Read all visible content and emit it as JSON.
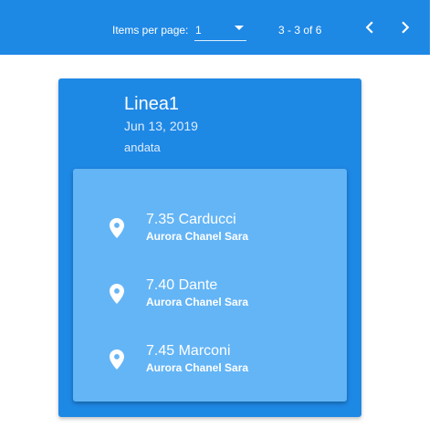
{
  "paginator": {
    "items_per_page_label": "Items per page:",
    "items_per_page_value": "1",
    "range_label": "3 - 3 of 6",
    "prev_icon": "chevron-left-icon",
    "next_icon": "chevron-right-icon"
  },
  "card": {
    "title": "Linea1",
    "date": "Jun 13, 2019",
    "subtitle": "andata",
    "stops": [
      {
        "title": "7.35 Carducci",
        "subtitle": "Aurora Chanel Sara",
        "icon": "location-pin-icon"
      },
      {
        "title": "7.40 Dante",
        "subtitle": "Aurora Chanel Sara",
        "icon": "location-pin-icon"
      },
      {
        "title": "7.45 Marconi",
        "subtitle": "Aurora Chanel Sara",
        "icon": "location-pin-icon"
      }
    ]
  },
  "colors": {
    "primary": "#1e88e5",
    "inner_card": "#64b5f6",
    "text": "#ffffff"
  }
}
